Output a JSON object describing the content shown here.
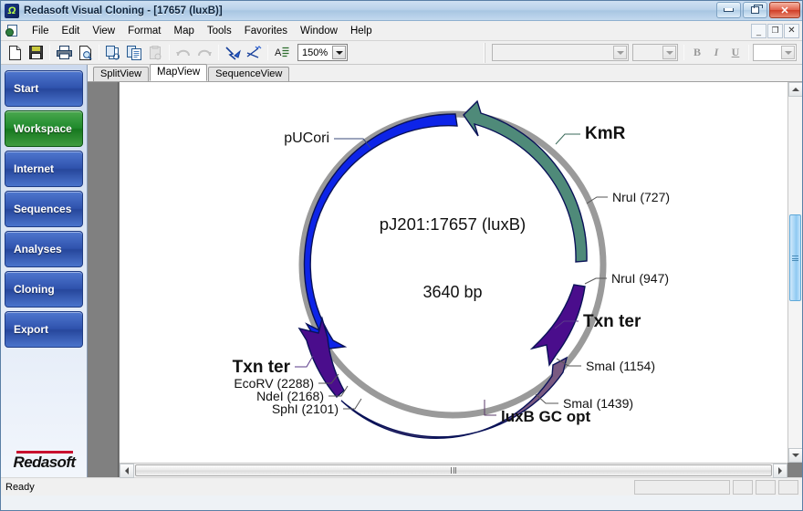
{
  "window": {
    "title": "Redasoft Visual Cloning - [17657 (luxB)]",
    "app_icon": "plasmid-icon",
    "minimize": "minimize",
    "maximize": "restore",
    "close": "close",
    "mdi_minimize": "_",
    "mdi_restore": "restore",
    "mdi_close": "x"
  },
  "menu": {
    "items": [
      {
        "label": "File"
      },
      {
        "label": "Edit"
      },
      {
        "label": "View"
      },
      {
        "label": "Format"
      },
      {
        "label": "Map"
      },
      {
        "label": "Tools"
      },
      {
        "label": "Favorites"
      },
      {
        "label": "Window"
      },
      {
        "label": "Help"
      }
    ]
  },
  "toolbar": {
    "buttons": [
      {
        "name": "new-document-icon",
        "enabled": true
      },
      {
        "name": "save-icon",
        "enabled": true
      },
      {
        "name": "print-icon",
        "enabled": true
      },
      {
        "name": "print-preview-icon",
        "enabled": true
      },
      {
        "name": "cut-icon",
        "enabled": true
      },
      {
        "name": "copy-icon",
        "enabled": true
      },
      {
        "name": "paste-icon",
        "enabled": false
      },
      {
        "name": "undo-icon",
        "enabled": false
      },
      {
        "name": "redo-icon",
        "enabled": false
      },
      {
        "name": "select-tool-icon",
        "enabled": true
      },
      {
        "name": "scissors-icon",
        "enabled": true
      },
      {
        "name": "text-properties-icon",
        "enabled": true
      }
    ],
    "zoom_value": "150%",
    "font_name": "",
    "font_size": "",
    "bold_label": "B",
    "italic_label": "I",
    "underline_label": "U",
    "color_value": ""
  },
  "sidebar": {
    "items": [
      {
        "label": "Start",
        "active": false
      },
      {
        "label": "Workspace",
        "active": true
      },
      {
        "label": "Internet",
        "active": false
      },
      {
        "label": "Sequences",
        "active": false
      },
      {
        "label": "Analyses",
        "active": false
      },
      {
        "label": "Cloning",
        "active": false
      },
      {
        "label": "Export",
        "active": false
      }
    ],
    "logo": "Redasoft"
  },
  "tabs": [
    {
      "label": "SplitView",
      "active": false
    },
    {
      "label": "MapView",
      "active": true
    },
    {
      "label": "SequenceView",
      "active": false
    }
  ],
  "map": {
    "plasmid_name": "pJ201:17657 (luxB)",
    "size_label": "3640 bp",
    "features": [
      {
        "name": "pUCori",
        "color": "#0d24e8",
        "label": "pUCori"
      },
      {
        "name": "KmR",
        "color": "#4f8a79",
        "label": "KmR"
      },
      {
        "name": "Txn ter right",
        "color": "#4a0d8c",
        "label": "Txn ter"
      },
      {
        "name": "luxB GC opt",
        "color": "#7a5a82",
        "label": "luxB GC opt"
      },
      {
        "name": "Txn ter left",
        "color": "#4a0d8c",
        "label": "Txn ter"
      }
    ],
    "sites": [
      {
        "label": "NruI (727)"
      },
      {
        "label": "NruI (947)"
      },
      {
        "label": "SmaI (1154)"
      },
      {
        "label": "SmaI (1439)"
      },
      {
        "label": "SphI (2101)"
      },
      {
        "label": "NdeI (2168)"
      },
      {
        "label": "EcoRV (2288)"
      }
    ]
  },
  "status": {
    "message": "Ready"
  }
}
